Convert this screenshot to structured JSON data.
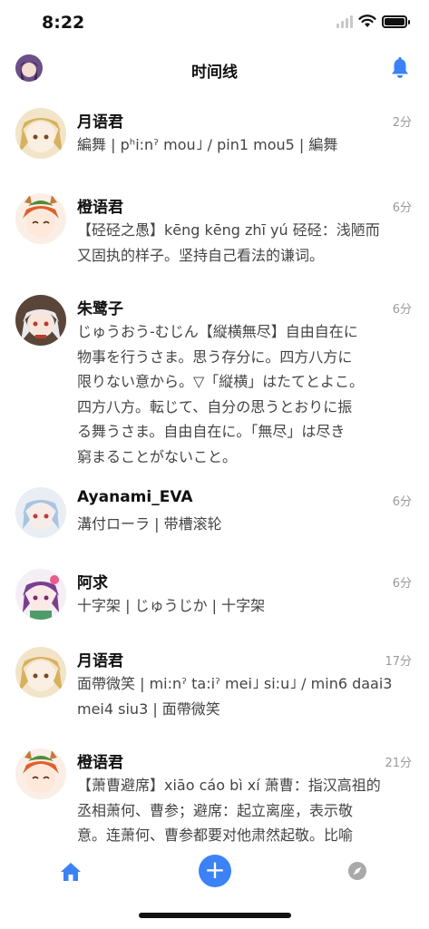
{
  "status_bar": {
    "time": "8:22"
  },
  "nav": {
    "title": "时间线"
  },
  "posts": [
    {
      "name": "月语君",
      "time": "2分",
      "text": "編舞 | pʰi:nˀ mou˩ / pin1 mou5 | 編舞"
    },
    {
      "name": "橙语君",
      "time": "6分",
      "text": "【硁硁之愚】kēng kēng zhī yú 硁硁：浅陋而\n又固执的样子。坚持自己看法的谦词。"
    },
    {
      "name": "朱鹭子",
      "time": "6分",
      "text": "じゅうおう-むじん【縦横無尽】自由自在に\n物事を行うさま。思う存分に。四方八方に\n限りない意から。▽「縦横」はたてとよこ。\n四方八方。転じて、自分の思うとおりに振\nる舞うさま。自由自在に。「無尽」は尽き\n窮まることがないこと。"
    },
    {
      "name": "Ayanami_EVA",
      "time": "6分",
      "text": "溝付ローラ | 带槽滚轮"
    },
    {
      "name": "阿求",
      "time": "6分",
      "text": "十字架 | じゅうじか | 十字架"
    },
    {
      "name": "月语君",
      "time": "17分",
      "text": "面帶微笑 | mi:nˀ ta:iˀ mei˩ si:u˩ / min6 daai3\nmei4 siu3 | 面帶微笑"
    },
    {
      "name": "橙语君",
      "time": "21分",
      "text": "【萧曹避席】xiāo cáo bì xí 萧曹：指汉高祖的\n丞相萧何、曹参；避席：起立离座，表示敬\n意。连萧何、曹参都要对他肃然起敬。比喻\n政治才能极大，超过前人。"
    }
  ],
  "tabbar": {
    "add_label": "+"
  },
  "colors": {
    "accent": "#3b82f6",
    "muted": "#9a9a9a",
    "text": "#444444"
  },
  "icons": [
    "wifi-icon",
    "battery-icon",
    "bell-icon",
    "home-icon",
    "add-icon",
    "compass-icon"
  ]
}
